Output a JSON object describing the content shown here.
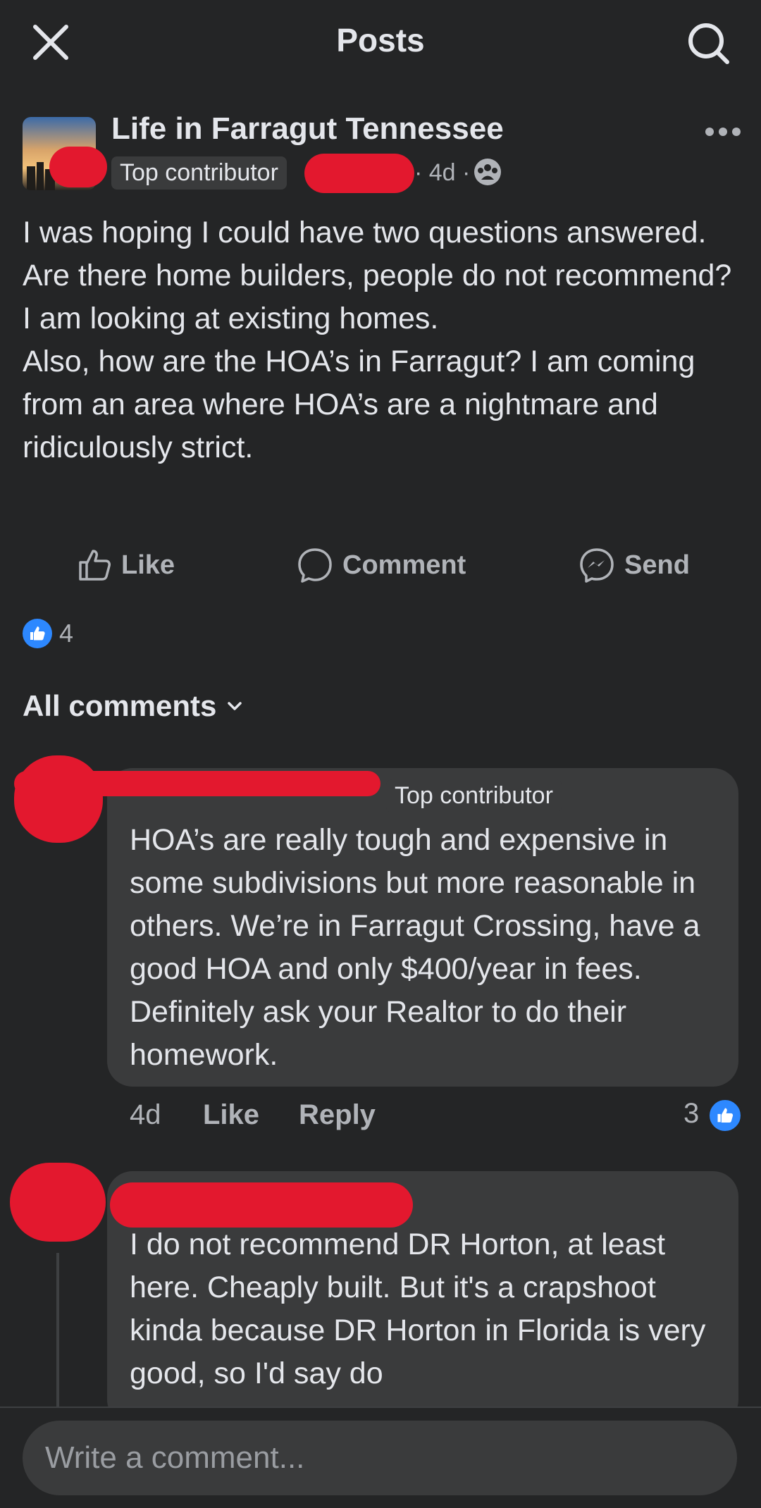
{
  "header": {
    "title": "Posts",
    "close_icon": "close-icon",
    "search_icon": "search-icon"
  },
  "post": {
    "group_name": "Life in Farragut Tennessee",
    "badge": "Top contributor",
    "time": "· 4d ·",
    "audience_icon": "group-audience-icon",
    "body": "I was hoping I could have two questions answered. Are there home builders, people do not recommend? I am looking at existing homes.\nAlso, how are the HOA’s in Farragut? I am coming from an area where HOA’s are a nightmare and ridiculously strict.",
    "actions": {
      "like": "Like",
      "comment": "Comment",
      "send": "Send"
    },
    "reaction_count": "4"
  },
  "comments_filter": "All comments",
  "comments": [
    {
      "badge": "Top contributor",
      "body": "HOA’s are really tough and expensive in some subdivisions but more reasonable in others. We’re in Farragut Crossing, have a good HOA and only $400/year in fees.  Definitely ask your Realtor to do their homework.",
      "time": "4d",
      "like": "Like",
      "reply": "Reply",
      "reaction_count": "3"
    },
    {
      "body": "I do not recommend DR Horton, at least here. Cheaply built. But it's a crapshoot kinda because DR Horton in Florida is very good, so I'd say do"
    }
  ],
  "composer": {
    "placeholder": "Write a comment..."
  },
  "colors": {
    "background": "#242526",
    "bubble": "#3a3b3c",
    "accent": "#2d88ff",
    "redaction": "#e3182e"
  }
}
